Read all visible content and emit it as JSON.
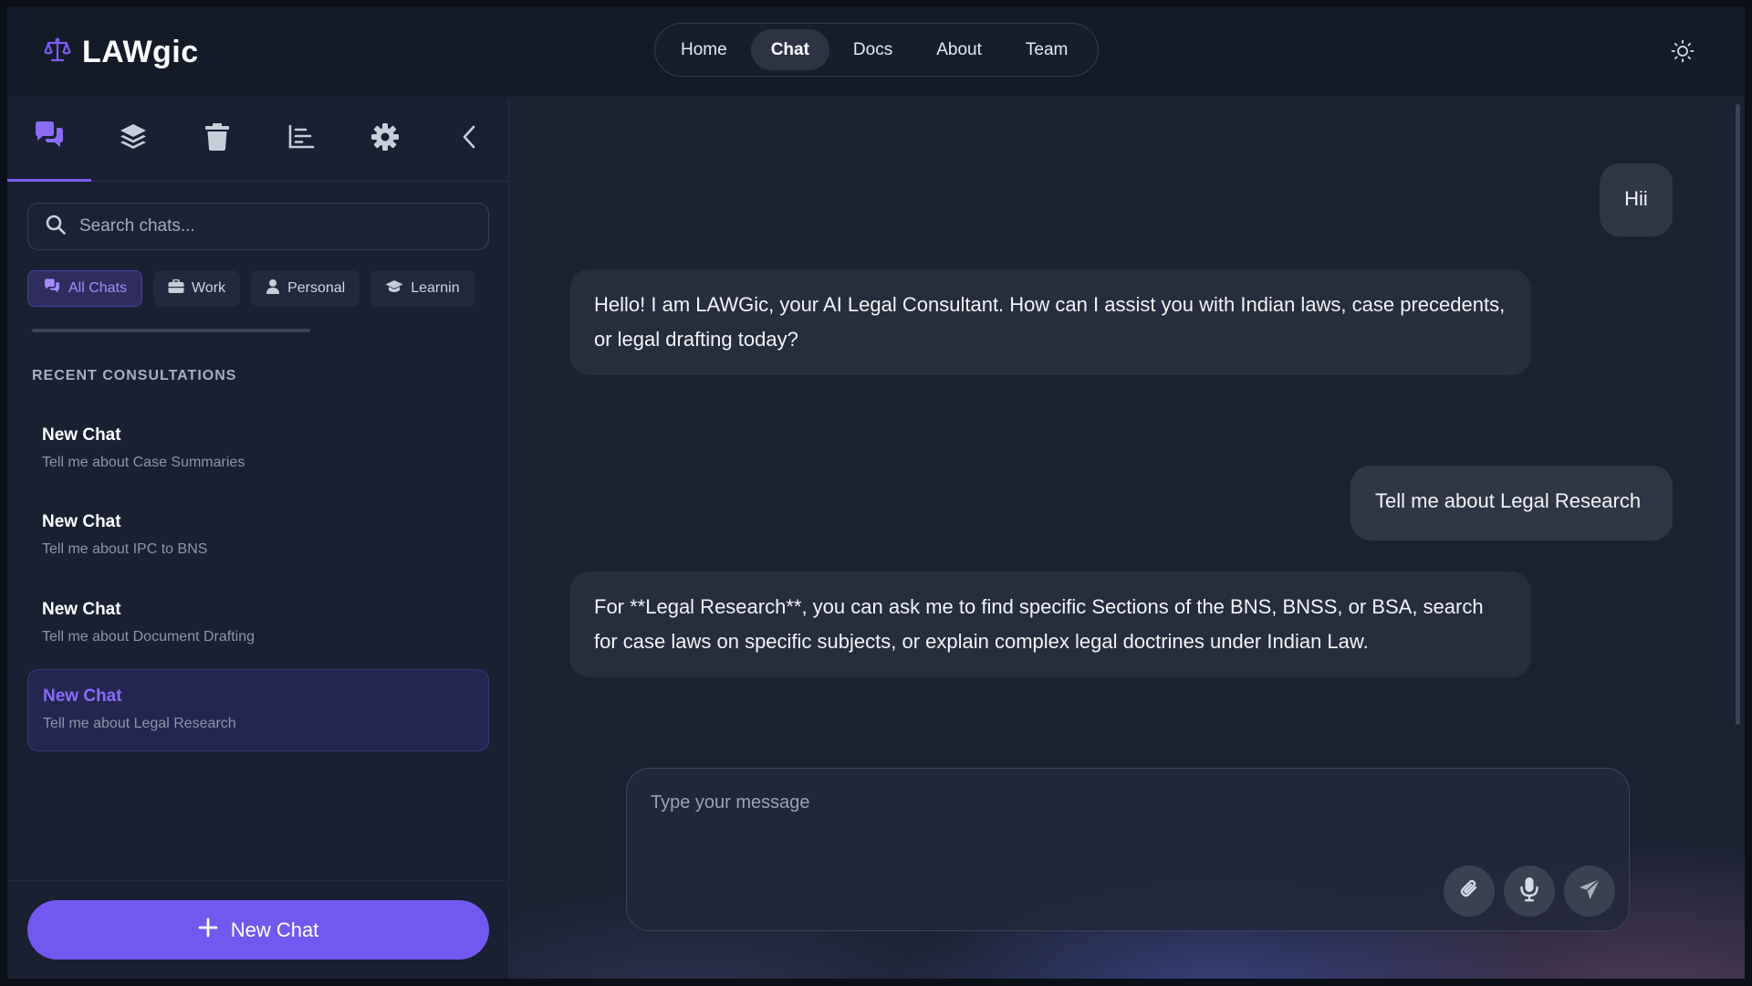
{
  "header": {
    "brand": "LAWgic",
    "nav": [
      {
        "label": "Home",
        "active": false
      },
      {
        "label": "Chat",
        "active": true
      },
      {
        "label": "Docs",
        "active": false
      },
      {
        "label": "About",
        "active": false
      },
      {
        "label": "Team",
        "active": false
      }
    ],
    "theme_icon": "sun-icon"
  },
  "sidebar": {
    "tab_icons": [
      "chats-icon",
      "layers-icon",
      "trash-icon",
      "chart-icon",
      "gear-icon",
      "chevron-left-icon"
    ],
    "search_placeholder": "Search chats...",
    "filters": [
      {
        "label": "All Chats",
        "icon": "chats-icon",
        "active": true
      },
      {
        "label": "Work",
        "icon": "briefcase-icon",
        "active": false
      },
      {
        "label": "Personal",
        "icon": "user-icon",
        "active": false
      },
      {
        "label": "Learnin",
        "icon": "graduation-cap-icon",
        "active": false
      }
    ],
    "section_title": "RECENT CONSULTATIONS",
    "conversations": [
      {
        "title": "New Chat",
        "subtitle": "Tell me about Case Summaries",
        "active": false
      },
      {
        "title": "New Chat",
        "subtitle": "Tell me about IPC to BNS",
        "active": false
      },
      {
        "title": "New Chat",
        "subtitle": "Tell me about Document Drafting",
        "active": false
      },
      {
        "title": "New Chat",
        "subtitle": "Tell me about Legal Research",
        "active": true
      }
    ],
    "new_chat_label": "New Chat"
  },
  "chat": {
    "messages": [
      {
        "role": "user",
        "text": "Hii"
      },
      {
        "role": "assistant",
        "text": "Hello! I am LAWGic, your AI Legal Consultant. How can I assist you with Indian laws, case precedents, or legal drafting today?"
      },
      {
        "role": "user",
        "text": "Tell me about Legal Research"
      },
      {
        "role": "assistant",
        "text": "For **Legal Research**, you can ask me to find specific Sections of the BNS, BNSS, or BSA, search for case laws on specific subjects, or explain complex legal doctrines under Indian Law."
      }
    ],
    "composer_placeholder": "Type your message",
    "composer_icons": [
      "paperclip-icon",
      "microphone-icon",
      "send-icon"
    ]
  },
  "colors": {
    "accent": "#7358f0",
    "accent_text": "#8a6cf7",
    "background": "#131a28"
  }
}
